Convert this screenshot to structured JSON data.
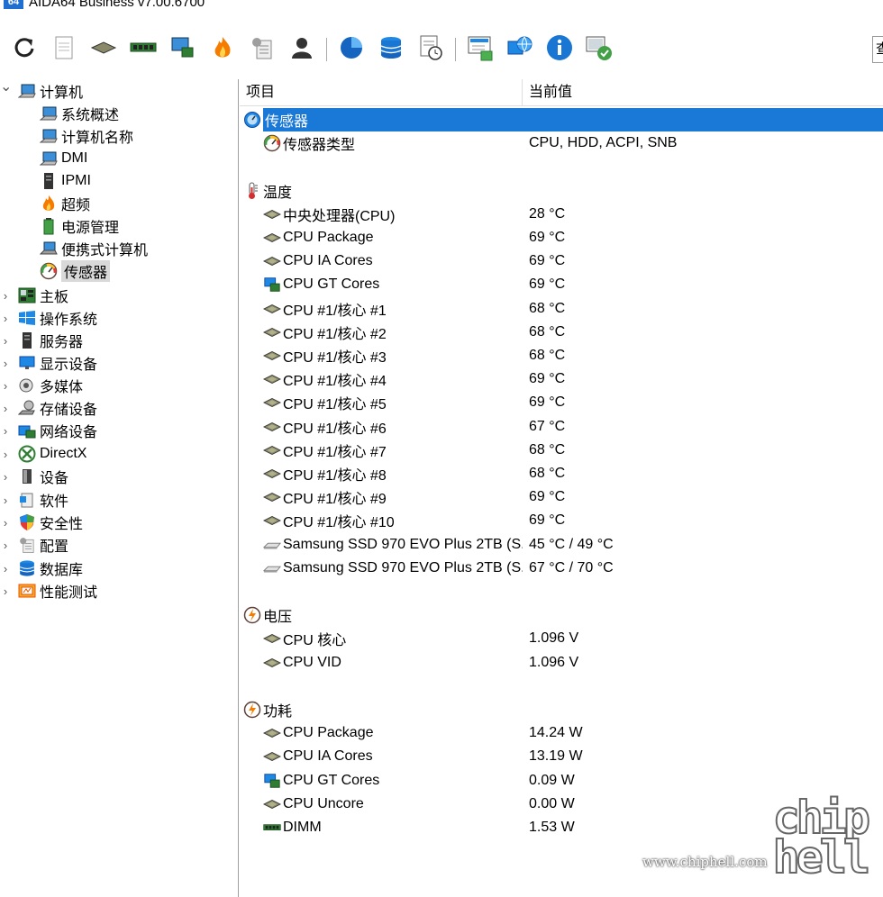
{
  "window": {
    "title": "AIDA64 Business v7.00.6700",
    "logo_text": "64"
  },
  "toolbar": {
    "buttons": [
      "refresh-icon",
      "report-icon",
      "motherboard-chip-icon",
      "memory-icon",
      "network-card-icon",
      "overclock-flame-icon",
      "config-icon",
      "user-icon",
      "disk-pie-icon",
      "database-icon",
      "scheduler-icon",
      "monitor-diag-icon",
      "network-globe-icon",
      "info-icon",
      "audit-icon"
    ],
    "search_text": "查"
  },
  "tree": {
    "items": [
      {
        "label": "计算机",
        "icon": "computer-icon",
        "expanded": true,
        "level": 0
      },
      {
        "label": "系统概述",
        "icon": "computer-icon",
        "level": 1
      },
      {
        "label": "计算机名称",
        "icon": "computer-icon",
        "level": 1
      },
      {
        "label": "DMI",
        "icon": "computer-icon",
        "level": 1
      },
      {
        "label": "IPMI",
        "icon": "server-icon",
        "level": 1
      },
      {
        "label": "超频",
        "icon": "flame-icon",
        "level": 1
      },
      {
        "label": "电源管理",
        "icon": "battery-icon",
        "level": 1
      },
      {
        "label": "便携式计算机",
        "icon": "laptop-icon",
        "level": 1
      },
      {
        "label": "传感器",
        "icon": "gauge-icon",
        "level": 1,
        "selected": true
      },
      {
        "label": "主板",
        "icon": "motherboard-icon",
        "level": 0
      },
      {
        "label": "操作系统",
        "icon": "windows-icon",
        "level": 0
      },
      {
        "label": "服务器",
        "icon": "server-icon",
        "level": 0
      },
      {
        "label": "显示设备",
        "icon": "display-icon",
        "level": 0
      },
      {
        "label": "多媒体",
        "icon": "speaker-icon",
        "level": 0
      },
      {
        "label": "存储设备",
        "icon": "storage-icon",
        "level": 0
      },
      {
        "label": "网络设备",
        "icon": "network-icon",
        "level": 0
      },
      {
        "label": "DirectX",
        "icon": "xbox-icon",
        "level": 0
      },
      {
        "label": "设备",
        "icon": "device-icon",
        "level": 0
      },
      {
        "label": "软件",
        "icon": "software-icon",
        "level": 0
      },
      {
        "label": "安全性",
        "icon": "shield-icon",
        "level": 0
      },
      {
        "label": "配置",
        "icon": "config-icon",
        "level": 0
      },
      {
        "label": "数据库",
        "icon": "database-icon",
        "level": 0
      },
      {
        "label": "性能测试",
        "icon": "benchmark-icon",
        "level": 0
      }
    ]
  },
  "list": {
    "header": {
      "item": "项目",
      "value": "当前值"
    },
    "rows": [
      {
        "type": "section",
        "label": "传感器",
        "icon": "sensor-icon",
        "highlight": true
      },
      {
        "type": "sub",
        "label": "传感器类型",
        "value": "CPU, HDD, ACPI, SNB",
        "icon": "gauge-icon"
      },
      {
        "type": "blank"
      },
      {
        "type": "section",
        "label": "温度",
        "icon": "thermometer-icon"
      },
      {
        "type": "sub",
        "label": "中央处理器(CPU)",
        "value": "28 °C",
        "icon": "cpu-icon"
      },
      {
        "type": "sub",
        "label": "CPU Package",
        "value": "69 °C",
        "icon": "cpu-icon"
      },
      {
        "type": "sub",
        "label": "CPU IA Cores",
        "value": "69 °C",
        "icon": "cpu-icon"
      },
      {
        "type": "sub",
        "label": "CPU GT Cores",
        "value": "69 °C",
        "icon": "gpu-icon"
      },
      {
        "type": "sub",
        "label": "CPU #1/核心 #1",
        "value": "68 °C",
        "icon": "cpu-icon"
      },
      {
        "type": "sub",
        "label": "CPU #1/核心 #2",
        "value": "68 °C",
        "icon": "cpu-icon"
      },
      {
        "type": "sub",
        "label": "CPU #1/核心 #3",
        "value": "68 °C",
        "icon": "cpu-icon"
      },
      {
        "type": "sub",
        "label": "CPU #1/核心 #4",
        "value": "69 °C",
        "icon": "cpu-icon"
      },
      {
        "type": "sub",
        "label": "CPU #1/核心 #5",
        "value": "69 °C",
        "icon": "cpu-icon"
      },
      {
        "type": "sub",
        "label": "CPU #1/核心 #6",
        "value": "67 °C",
        "icon": "cpu-icon"
      },
      {
        "type": "sub",
        "label": "CPU #1/核心 #7",
        "value": "68 °C",
        "icon": "cpu-icon"
      },
      {
        "type": "sub",
        "label": "CPU #1/核心 #8",
        "value": "68 °C",
        "icon": "cpu-icon"
      },
      {
        "type": "sub",
        "label": "CPU #1/核心 #9",
        "value": "69 °C",
        "icon": "cpu-icon"
      },
      {
        "type": "sub",
        "label": "CPU #1/核心 #10",
        "value": "69 °C",
        "icon": "cpu-icon"
      },
      {
        "type": "sub",
        "label": "Samsung SSD 970 EVO Plus 2TB (S...",
        "value": "45 °C / 49 °C",
        "icon": "ssd-icon"
      },
      {
        "type": "sub",
        "label": "Samsung SSD 970 EVO Plus 2TB (S...",
        "value": "67 °C / 70 °C",
        "icon": "ssd-icon"
      },
      {
        "type": "blank"
      },
      {
        "type": "section",
        "label": "电压",
        "icon": "voltage-icon"
      },
      {
        "type": "sub",
        "label": "CPU 核心",
        "value": "1.096 V",
        "icon": "cpu-icon"
      },
      {
        "type": "sub",
        "label": "CPU VID",
        "value": "1.096 V",
        "icon": "cpu-icon"
      },
      {
        "type": "blank"
      },
      {
        "type": "section",
        "label": "功耗",
        "icon": "power-icon"
      },
      {
        "type": "sub",
        "label": "CPU Package",
        "value": "14.24 W",
        "icon": "cpu-icon"
      },
      {
        "type": "sub",
        "label": "CPU IA Cores",
        "value": "13.19 W",
        "icon": "cpu-icon"
      },
      {
        "type": "sub",
        "label": "CPU GT Cores",
        "value": "0.09 W",
        "icon": "gpu-icon"
      },
      {
        "type": "sub",
        "label": "CPU Uncore",
        "value": "0.00 W",
        "icon": "cpu-icon"
      },
      {
        "type": "sub",
        "label": "DIMM",
        "value": "1.53 W",
        "icon": "memory-icon"
      }
    ]
  },
  "watermark": {
    "url": "www.chiphell.com",
    "logo": "chip hell"
  },
  "colors": {
    "selection": "#1a78d6",
    "accent_blue": "#1f6fd1"
  }
}
